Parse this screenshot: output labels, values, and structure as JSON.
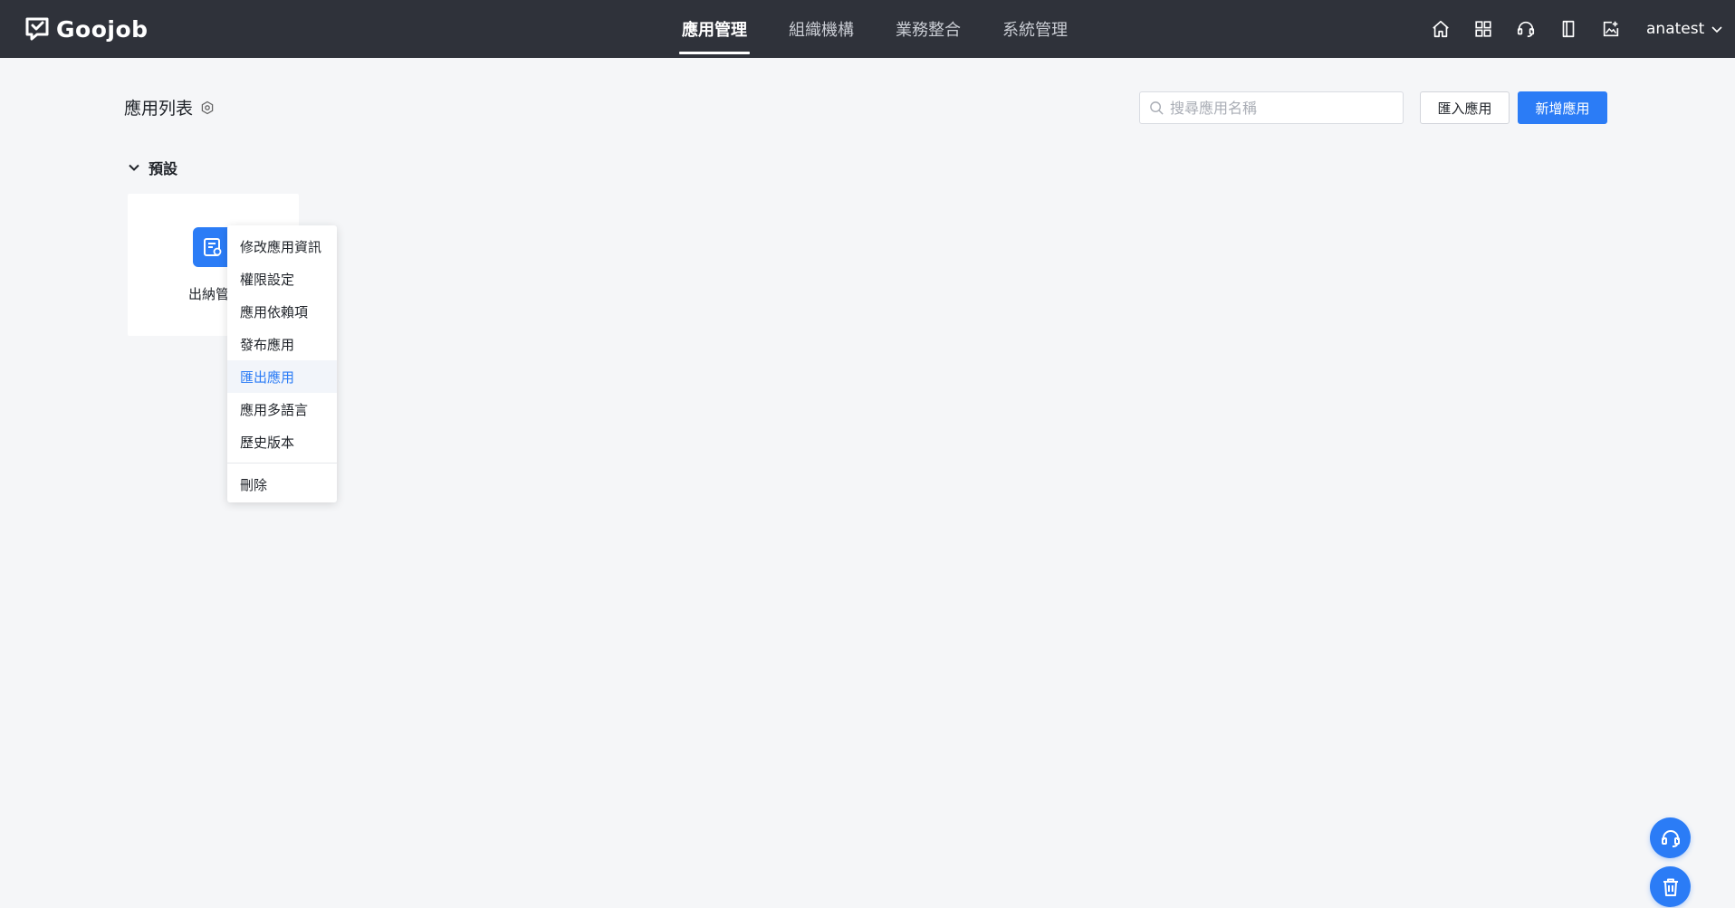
{
  "brand": {
    "name": "Goojob"
  },
  "nav": {
    "tabs": [
      {
        "label": "應用管理",
        "active": true
      },
      {
        "label": "組織機構",
        "active": false
      },
      {
        "label": "業務整合",
        "active": false
      },
      {
        "label": "系統管理",
        "active": false
      }
    ]
  },
  "header_icons": [
    "home-icon",
    "grid-icon",
    "headset-icon",
    "book-icon",
    "image-edit-icon"
  ],
  "user": {
    "name": "anatest"
  },
  "page": {
    "title": "應用列表",
    "search_placeholder": "搜尋應用名稱",
    "import_label": "匯入應用",
    "new_label": "新增應用"
  },
  "group": {
    "label": "預設",
    "apps": [
      {
        "name": "出納管"
      }
    ]
  },
  "context_menu": {
    "items": [
      {
        "label": "修改應用資訊"
      },
      {
        "label": "權限設定"
      },
      {
        "label": "應用依賴項"
      },
      {
        "label": "發布應用"
      },
      {
        "label": "匯出應用",
        "highlighted": true
      },
      {
        "label": "應用多語言"
      },
      {
        "label": "歷史版本"
      }
    ],
    "danger_item": "刪除"
  },
  "colors": {
    "topbar": "#2f323a",
    "primary": "#2b7cf6",
    "page_bg": "#f5f6f8"
  }
}
